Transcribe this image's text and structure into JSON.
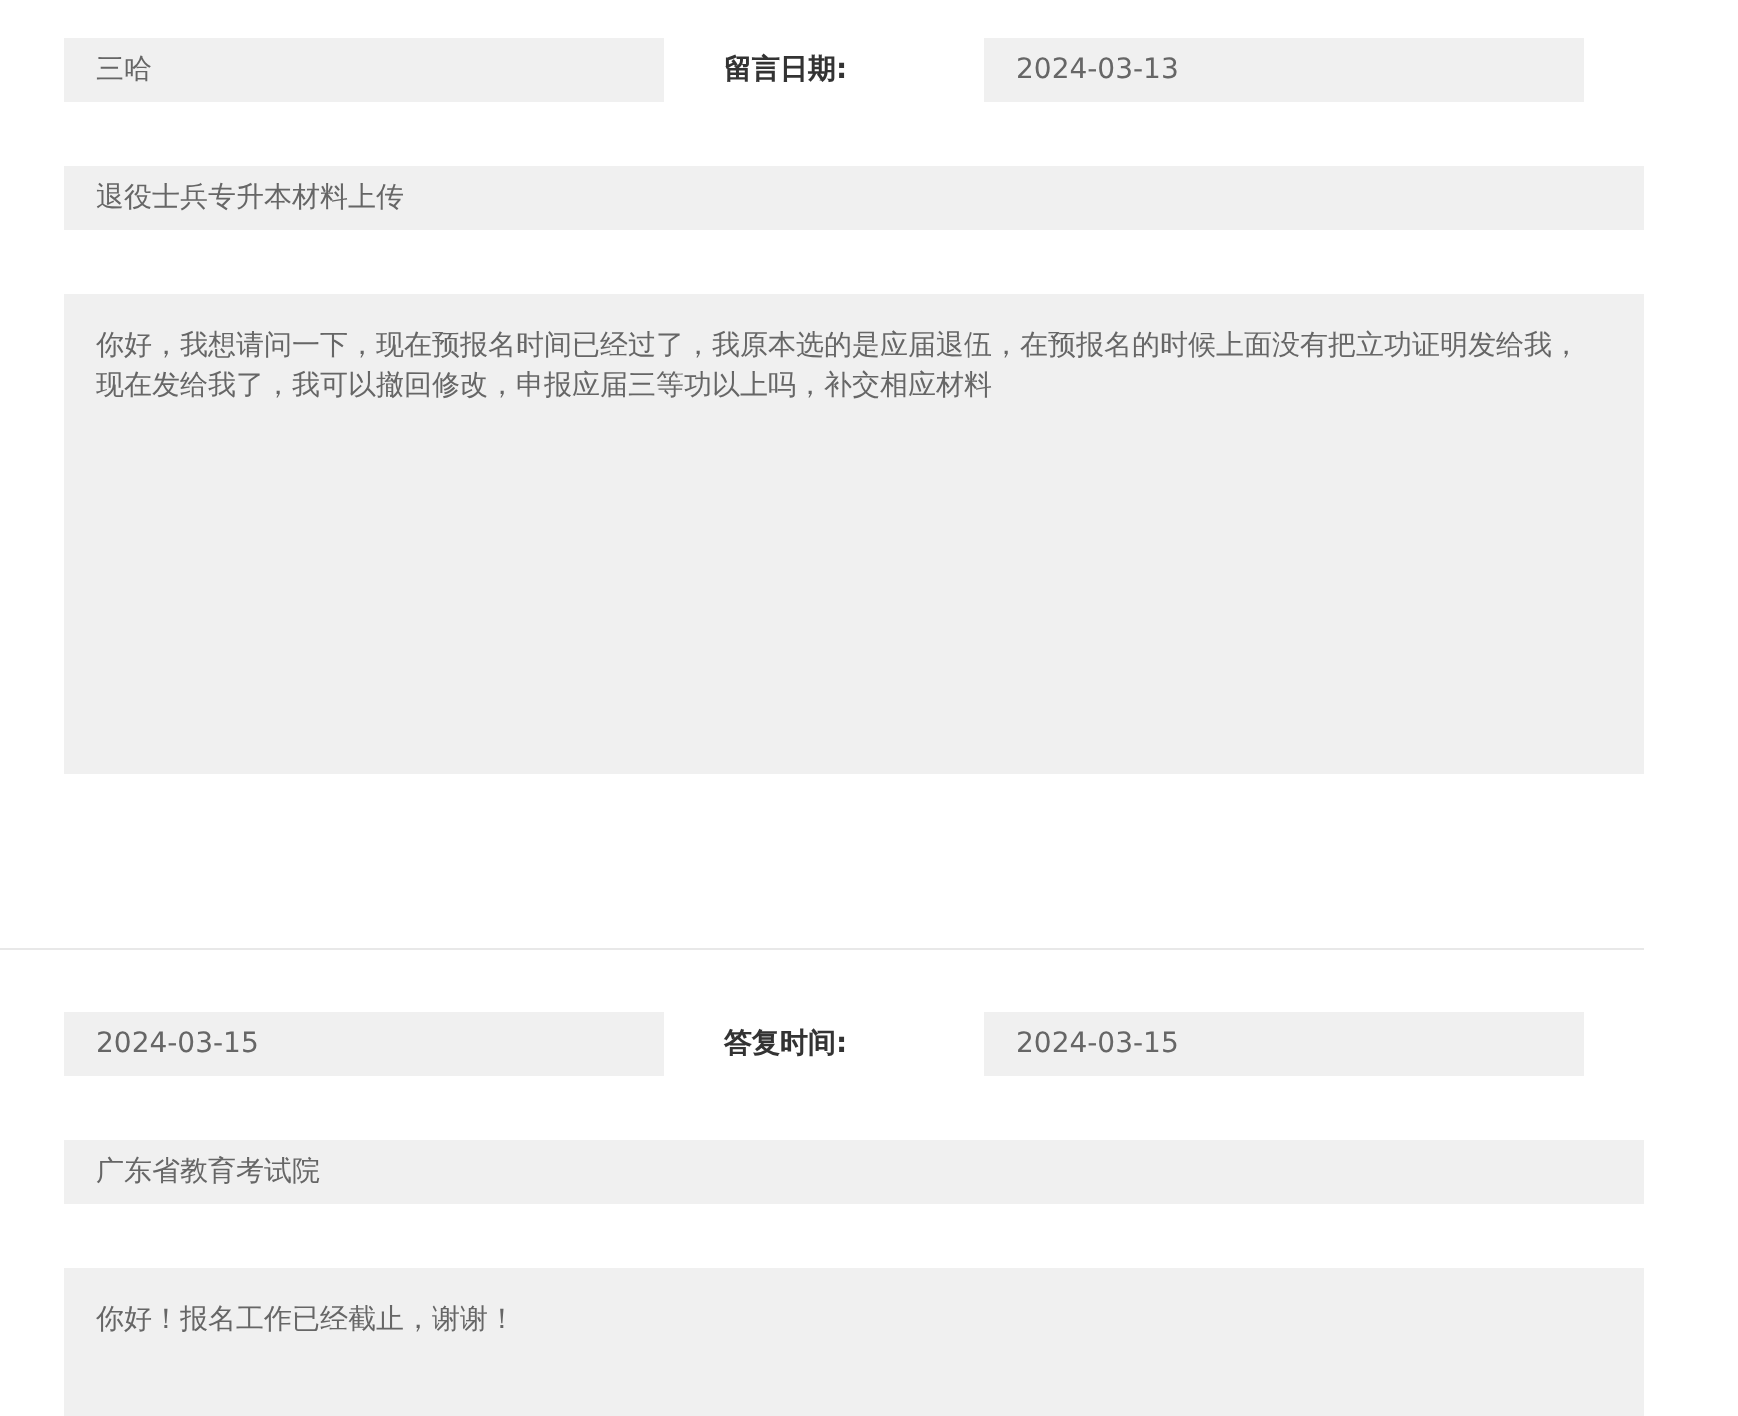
{
  "question": {
    "name": "三哈",
    "date_label": "留言日期:",
    "date": "2024-03-13",
    "subject": "退役士兵专升本材料上传",
    "content": "你好，我想请问一下，现在预报名时间已经过了，我原本选的是应届退伍，在预报名的时候上面没有把立功证明发给我，现在发给我了，我可以撤回修改，申报应届三等功以上吗，补交相应材料"
  },
  "reply": {
    "date": "2024-03-15",
    "time_label": "答复时间:",
    "time": "2024-03-15",
    "department": "广东省教育考试院",
    "content": "你好！报名工作已经截止，谢谢！"
  }
}
